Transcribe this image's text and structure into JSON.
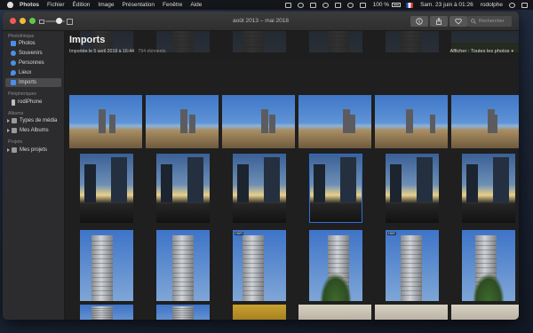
{
  "menubar": {
    "items": [
      "Photos",
      "Fichier",
      "Édition",
      "Image",
      "Présentation",
      "Fenêtre",
      "Aide"
    ],
    "battery": "100 %",
    "datetime": "Sam. 23 juin à 01:26",
    "username": "rodolphe"
  },
  "window": {
    "title": "août 2013 – mai 2018",
    "search_placeholder": "Rechercher"
  },
  "sidebar": {
    "sections": [
      {
        "title": "Photothèque",
        "items": [
          {
            "label": "Photos",
            "icon": "photos-icon",
            "color": "#4c8fe8"
          },
          {
            "label": "Souvenirs",
            "icon": "memories-icon",
            "color": "#4c8fe8"
          },
          {
            "label": "Personnes",
            "icon": "people-icon",
            "color": "#4c8fe8"
          },
          {
            "label": "Lieux",
            "icon": "places-icon",
            "color": "#4c8fe8"
          },
          {
            "label": "Imports",
            "icon": "imports-icon",
            "color": "#4c8fe8",
            "selected": true
          }
        ]
      },
      {
        "title": "Périphériques",
        "items": [
          {
            "label": "rodiPhone",
            "icon": "iphone-icon",
            "color": "#bdbdbd"
          }
        ]
      },
      {
        "title": "Albums",
        "items": [
          {
            "label": "Types de média",
            "icon": "folder-icon",
            "color": "#9a9a9a",
            "disclosure": true
          },
          {
            "label": "Mes Albums",
            "icon": "folder-icon",
            "color": "#9a9a9a",
            "disclosure": true
          }
        ]
      },
      {
        "title": "Projets",
        "items": [
          {
            "label": "Mes projets",
            "icon": "folder-icon",
            "color": "#9a9a9a",
            "disclosure": true
          }
        ]
      }
    ]
  },
  "main": {
    "title": "Imports",
    "subtitle": "Importée le 5 avril 2018 à 16:44",
    "count": "794 éléments",
    "filter_label": "Afficher : Toutes les photos"
  },
  "photos": {
    "rows": [
      [
        "tower",
        "tower",
        "tower",
        "tower",
        "tower",
        "grass"
      ],
      [
        "beach",
        "beach",
        "beach",
        "beach",
        "beach",
        "beach"
      ],
      [
        "sunset",
        "sunset",
        "sunset",
        "sunset",
        "sunset",
        "sunset"
      ],
      [
        "tower",
        "tower",
        "tower",
        "tower",
        "tower",
        "tower"
      ],
      [
        "tower",
        "tower",
        "gold",
        "interior",
        "interior",
        "interior"
      ]
    ],
    "hdr_badge": "HDR",
    "selected": [
      2,
      3
    ]
  },
  "colors": {
    "accent": "#2d6fd9",
    "selection": "#4a4a4d"
  }
}
